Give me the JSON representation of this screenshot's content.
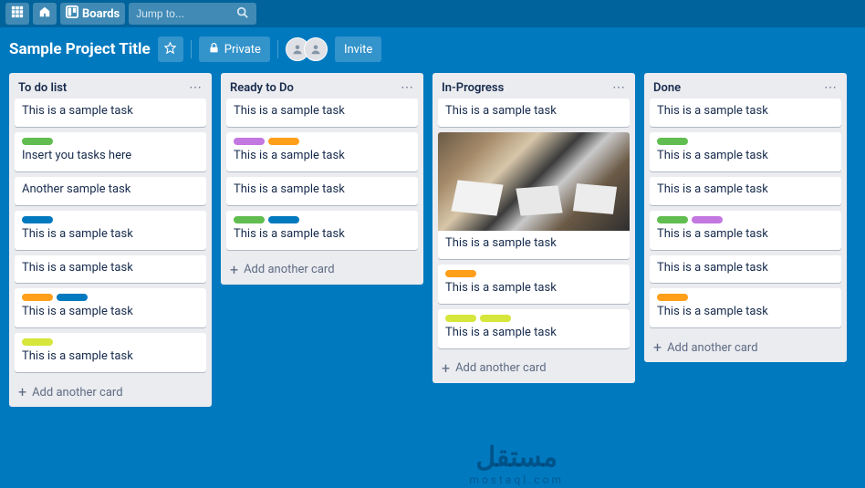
{
  "nav": {
    "boards_label": "Boards",
    "search_placeholder": "Jump to..."
  },
  "header": {
    "title": "Sample Project Title",
    "private_label": "Private",
    "invite_label": "Invite"
  },
  "colors": {
    "green": "#61bd4f",
    "yellow": "#f2d600",
    "orange": "#ff9f1a",
    "blue": "#0079bf",
    "purple": "#c377e0",
    "lime": "#d6e63a"
  },
  "lists": [
    {
      "title": "To do list",
      "cards": [
        {
          "labels": [],
          "text": "This is a sample task"
        },
        {
          "labels": [
            "green"
          ],
          "text": "Insert you tasks here"
        },
        {
          "labels": [],
          "text": "Another sample task"
        },
        {
          "labels": [
            "blue"
          ],
          "text": "This is a sample task"
        },
        {
          "labels": [],
          "text": "This is a sample task"
        },
        {
          "labels": [
            "orange",
            "blue"
          ],
          "text": "This is a sample task"
        },
        {
          "labels": [
            "lime"
          ],
          "text": "This is a sample task"
        }
      ]
    },
    {
      "title": "Ready to Do",
      "cards": [
        {
          "labels": [],
          "text": "This is a sample task"
        },
        {
          "labels": [
            "purple",
            "orange"
          ],
          "text": "This is a sample task"
        },
        {
          "labels": [],
          "text": "This is a sample task"
        },
        {
          "labels": [
            "green",
            "blue"
          ],
          "text": "This is a sample task"
        }
      ]
    },
    {
      "title": "In-Progress",
      "cards": [
        {
          "labels": [],
          "text": "This is a sample task"
        },
        {
          "labels": [],
          "text": "This is a sample task",
          "cover": true
        },
        {
          "labels": [
            "orange"
          ],
          "text": "This is a sample task"
        },
        {
          "labels": [
            "lime",
            "lime"
          ],
          "text": "This is a sample task"
        }
      ]
    },
    {
      "title": "Done",
      "cards": [
        {
          "labels": [],
          "text": "This is a sample task"
        },
        {
          "labels": [
            "green"
          ],
          "text": "This is a sample task"
        },
        {
          "labels": [],
          "text": "This is a sample task"
        },
        {
          "labels": [
            "green",
            "purple"
          ],
          "text": "This is a sample task"
        },
        {
          "labels": [],
          "text": "This is a sample task"
        },
        {
          "labels": [
            "orange"
          ],
          "text": "This is a sample task"
        }
      ]
    }
  ],
  "add_card_label": "Add another card",
  "watermark": {
    "big": "مستقل",
    "small": "mostaql.com"
  }
}
